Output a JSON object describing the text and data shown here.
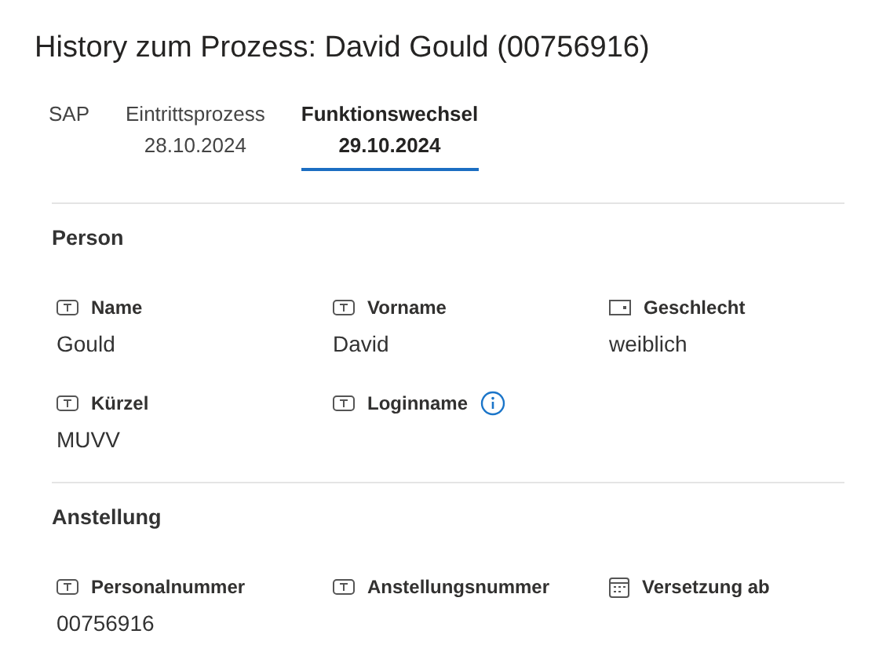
{
  "title": "History zum Prozess: David Gould (00756916)",
  "tabs": [
    {
      "label": "SAP",
      "selected": false
    },
    {
      "label": "Eintrittsprozess",
      "date": "28.10.2024",
      "selected": false
    },
    {
      "label": "Funktionswechsel",
      "date": "29.10.2024",
      "selected": true
    }
  ],
  "sections": [
    {
      "title": "Person",
      "fields": [
        {
          "kind": "text",
          "label": "Name",
          "value": "Gould"
        },
        {
          "kind": "text",
          "label": "Vorname",
          "value": "David"
        },
        {
          "kind": "choice",
          "label": "Geschlecht",
          "value": "weiblich"
        },
        {
          "kind": "text",
          "label": "Kürzel",
          "value": "MUVV"
        },
        {
          "kind": "text",
          "label": "Loginname",
          "info": true
        }
      ]
    },
    {
      "title": "Anstellung",
      "fields": [
        {
          "kind": "text",
          "label": "Personalnummer",
          "value": "00756916"
        },
        {
          "kind": "text",
          "label": "Anstellungsnummer"
        },
        {
          "kind": "date",
          "label": "Versetzung ab"
        }
      ]
    }
  ]
}
